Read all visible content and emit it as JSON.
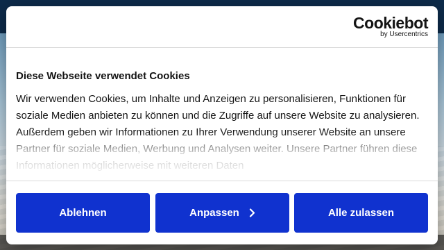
{
  "banner": {
    "brand_name": "Cookiebot",
    "brand_sub": "by Usercentrics",
    "title": "Diese Webseite verwendet Cookies",
    "text": "Wir verwenden Cookies, um Inhalte und Anzeigen zu personalisieren, Funktionen für soziale Medien anbieten zu können und die Zugriffe auf unsere Website zu analysieren. Außerdem geben wir Informationen zu Ihrer Verwendung unserer Website an unsere Partner für soziale Medien, Werbung und Analysen weiter. Unsere Partner führen diese Informationen möglicherweise mit weiteren Daten"
  },
  "buttons": {
    "decline_label": "Ablehnen",
    "customize_label": "Anpassen",
    "allow_all_label": "Alle zulassen"
  },
  "colors": {
    "accent": "#1032cf",
    "text": "#141414",
    "divider": "#d9d9d9"
  },
  "icons": {
    "customize_chevron": "chevron-right-icon"
  }
}
